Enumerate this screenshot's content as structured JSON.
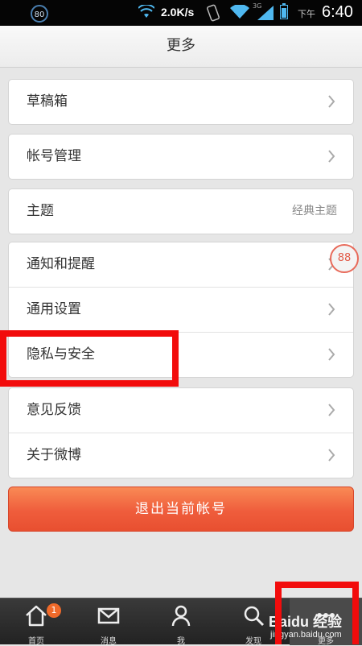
{
  "status_bar": {
    "badge": "80",
    "speed": "2.0K/s",
    "network": "3G",
    "ampm": "下午",
    "time": "6:40"
  },
  "header": {
    "title": "更多"
  },
  "groups": [
    {
      "items": [
        {
          "label": "草稿箱"
        }
      ]
    },
    {
      "items": [
        {
          "label": "帐号管理"
        }
      ]
    },
    {
      "items": [
        {
          "label": "主题",
          "value": "经典主题"
        }
      ]
    },
    {
      "items": [
        {
          "label": "通知和提醒"
        },
        {
          "label": "通用设置"
        },
        {
          "label": "隐私与安全"
        }
      ]
    },
    {
      "items": [
        {
          "label": "意见反馈"
        },
        {
          "label": "关于微博"
        }
      ]
    }
  ],
  "floating_badge": "88",
  "logout_label": "退出当前帐号",
  "tabbar": {
    "tabs": [
      {
        "label": "首页",
        "icon": "home-icon",
        "badge": "1"
      },
      {
        "label": "消息",
        "icon": "message-icon"
      },
      {
        "label": "我",
        "icon": "profile-icon"
      },
      {
        "label": "发现",
        "icon": "search-icon"
      },
      {
        "label": "更多",
        "icon": "more-icon"
      }
    ]
  },
  "watermark": {
    "logo": "Baidu 经验",
    "url": "jingyan.baidu.com"
  },
  "colors": {
    "accent": "#ef5d3c",
    "highlight": "#f20c0c",
    "tabbar": "#2a2a2a"
  }
}
